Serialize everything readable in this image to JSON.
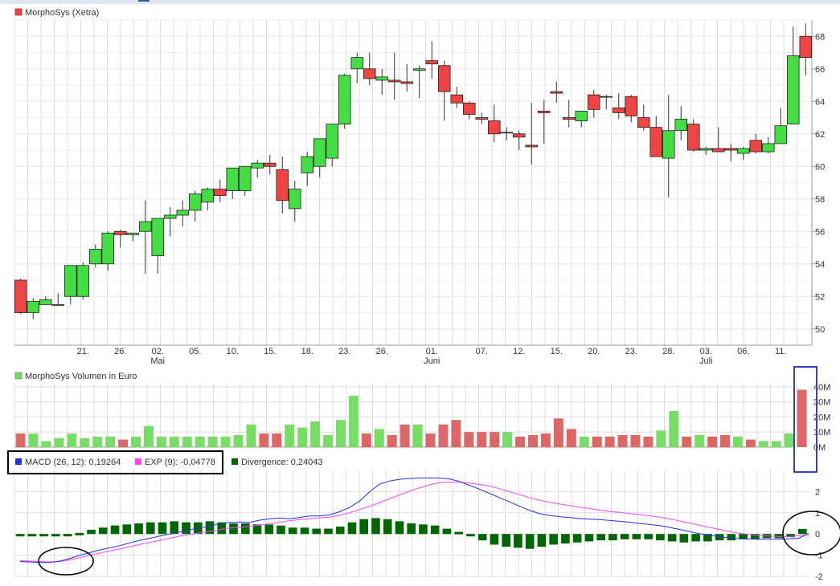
{
  "colors": {
    "up": "#44dd44",
    "down": "#ee4444",
    "vol_up": "#77dd66",
    "vol_down": "#dd6666",
    "macd": "#2233dd",
    "exp": "#ff44ff",
    "divergence": "#006600",
    "grid": "#dddddd",
    "highlight_box": "#3344bb"
  },
  "price_panel": {
    "legend": "MorphoSys (Xetra)",
    "y_ticks": [
      "50",
      "52",
      "54",
      "56",
      "58",
      "60",
      "62",
      "64",
      "66",
      "68"
    ],
    "x_ticks": [
      "21.",
      "26.",
      "02.",
      "05.",
      "10.",
      "15.",
      "18.",
      "23.",
      "26.",
      "01.",
      "07.",
      "12.",
      "15.",
      "20.",
      "23.",
      "28.",
      "03.",
      "06.",
      "11."
    ],
    "month_labels": [
      "Mai",
      "Juni",
      "Juli"
    ]
  },
  "volume_panel": {
    "legend": "MorphoSys Volumen in Euro",
    "y_ticks": [
      "0M",
      "10M",
      "20M",
      "30M",
      "40M"
    ]
  },
  "macd_panel": {
    "macd_legend": "MACD (26, 12): 0,19264",
    "exp_legend": "EXP (9): -0,04778",
    "div_legend": "Divergence: 0,24043",
    "y_ticks": [
      "-2",
      "-1",
      "0",
      "1",
      "2"
    ]
  },
  "chart_data": [
    {
      "type": "candlestick",
      "title": "MorphoSys (Xetra)",
      "ylim": [
        49,
        69
      ],
      "x": [
        "16.04",
        "17.04",
        "18.04",
        "19.04",
        "20.04",
        "21.04",
        "24.04",
        "25.04",
        "26.04",
        "27.04",
        "28.04",
        "02.05",
        "03.05",
        "04.05",
        "05.05",
        "08.05",
        "09.05",
        "10.05",
        "11.05",
        "12.05",
        "15.05",
        "16.05",
        "17.05",
        "18.05",
        "19.05",
        "22.05",
        "23.05",
        "24.05",
        "25.05",
        "26.05",
        "29.05",
        "30.05",
        "31.05",
        "01.06",
        "02.06",
        "05.06",
        "06.06",
        "07.06",
        "08.06",
        "09.06",
        "12.06",
        "13.06",
        "14.06",
        "15.06",
        "16.06",
        "19.06",
        "20.06",
        "21.06",
        "22.06",
        "23.06",
        "26.06",
        "27.06",
        "28.06",
        "29.06",
        "30.06",
        "03.07",
        "04.07",
        "05.07",
        "06.07",
        "07.07",
        "10.07",
        "11.07",
        "12.07",
        "13.07"
      ],
      "open": [
        53.0,
        51.0,
        51.5,
        51.5,
        52.0,
        52.0,
        54.0,
        54.0,
        56.0,
        55.8,
        56.0,
        54.5,
        56.8,
        57.0,
        57.3,
        57.8,
        58.6,
        58.5,
        58.5,
        59.9,
        60.2,
        59.8,
        57.4,
        59.6,
        60.0,
        60.5,
        62.6,
        66.0,
        66.0,
        65.3,
        65.3,
        65.2,
        65.9,
        66.5,
        66.2,
        64.4,
        63.9,
        63.0,
        62.8,
        62.1,
        62.0,
        61.3,
        63.4,
        64.6,
        63.0,
        62.8,
        64.4,
        64.3,
        63.6,
        64.3,
        63.0,
        62.4,
        60.5,
        62.2,
        62.6,
        61.0,
        61.1,
        61.1,
        60.8,
        61.6,
        60.9,
        61.4,
        62.6,
        68.0
      ],
      "high": [
        53.1,
        51.9,
        52.0,
        52.2,
        53.9,
        54.1,
        55.2,
        56.0,
        56.1,
        55.9,
        57.9,
        56.6,
        57.5,
        57.9,
        58.5,
        58.7,
        59.2,
        59.0,
        59.9,
        60.4,
        60.7,
        60.6,
        59.1,
        60.9,
        60.8,
        62.6,
        65.7,
        67.0,
        67.0,
        66.0,
        67.0,
        66.3,
        66.2,
        67.7,
        66.5,
        64.9,
        64.0,
        63.3,
        63.8,
        62.4,
        62.2,
        63.9,
        64.1,
        65.2,
        64.1,
        63.3,
        64.7,
        64.4,
        64.5,
        64.4,
        63.8,
        63.1,
        64.4,
        63.7,
        62.9,
        61.2,
        62.4,
        61.4,
        61.2,
        62.0,
        61.8,
        63.6,
        68.6,
        68.8
      ],
      "low": [
        50.9,
        50.6,
        51.5,
        51.5,
        51.5,
        51.8,
        53.8,
        53.6,
        55.0,
        55.4,
        53.4,
        53.4,
        55.7,
        56.3,
        56.6,
        57.3,
        57.8,
        58.0,
        58.2,
        59.3,
        59.5,
        57.1,
        56.6,
        58.8,
        59.3,
        60.0,
        62.3,
        65.1,
        65.0,
        64.4,
        64.1,
        64.6,
        64.2,
        65.4,
        62.8,
        63.6,
        62.9,
        62.6,
        61.5,
        61.6,
        61.0,
        60.1,
        61.4,
        63.9,
        62.4,
        62.4,
        63.0,
        63.5,
        62.9,
        62.7,
        62.2,
        60.6,
        58.1,
        61.6,
        60.9,
        60.7,
        61.0,
        60.3,
        60.4,
        60.8,
        60.8,
        61.6,
        65.8,
        65.6
      ],
      "close": [
        51.0,
        51.7,
        51.8,
        51.5,
        53.9,
        53.9,
        54.9,
        55.9,
        55.8,
        55.9,
        56.6,
        56.8,
        57.0,
        57.3,
        58.3,
        58.6,
        58.2,
        59.9,
        60.0,
        60.2,
        60.0,
        57.9,
        58.6,
        60.6,
        61.7,
        62.6,
        65.6,
        66.7,
        65.4,
        65.5,
        65.2,
        65.1,
        66.0,
        66.3,
        64.6,
        63.9,
        63.2,
        62.9,
        62.0,
        62.1,
        61.8,
        61.2,
        63.3,
        64.5,
        62.9,
        63.4,
        63.5,
        64.3,
        63.3,
        63.1,
        62.4,
        60.6,
        62.2,
        62.9,
        61.0,
        61.1,
        60.9,
        61.0,
        61.1,
        60.9,
        61.4,
        62.5,
        66.8,
        66.7
      ]
    },
    {
      "type": "bar",
      "title": "MorphoSys Volumen in Euro",
      "ylim": [
        0,
        40
      ],
      "values": [
        9,
        9,
        4,
        6,
        9,
        6,
        7,
        7,
        5,
        7,
        14,
        7,
        7,
        7,
        7,
        7,
        7,
        8,
        15,
        9,
        9,
        15,
        13,
        17,
        8,
        18,
        34,
        9,
        12,
        8,
        15,
        15,
        9,
        15,
        18,
        10,
        10,
        10,
        10,
        7,
        8,
        9,
        19,
        12,
        7,
        7,
        7,
        8,
        8,
        7,
        11,
        24,
        7,
        8,
        7,
        8,
        7,
        5,
        4,
        4,
        9,
        38
      ]
    },
    {
      "type": "bar+line",
      "title": "MACD",
      "ylim": [
        -2,
        3
      ],
      "macd": [
        -1.3,
        -1.32,
        -1.35,
        -1.35,
        -1.28,
        -1.15,
        -1.0,
        -0.88,
        -0.75,
        -0.65,
        -0.55,
        -0.42,
        -0.3,
        -0.2,
        -0.1,
        0.0,
        0.1,
        0.2,
        0.3,
        0.36,
        0.5,
        0.55,
        0.57,
        0.55,
        0.65,
        0.72,
        0.75,
        0.72,
        0.78,
        0.85,
        0.85,
        0.9,
        1.05,
        1.25,
        1.55,
        1.98,
        2.35,
        2.5,
        2.58,
        2.62,
        2.64,
        2.65,
        2.64,
        2.6,
        2.48,
        2.3,
        2.12,
        1.92,
        1.72,
        1.52,
        1.32,
        1.12,
        0.97,
        0.88,
        0.82,
        0.78,
        0.73,
        0.7,
        0.68,
        0.64,
        0.6,
        0.56,
        0.5,
        0.45,
        0.4,
        0.32,
        0.22,
        0.12,
        0.02,
        -0.06,
        -0.12,
        -0.18,
        -0.22,
        -0.24,
        -0.25,
        -0.25,
        -0.25,
        -0.23,
        -0.2,
        0.03
      ],
      "exp": [
        -1.25,
        -1.28,
        -1.3,
        -1.32,
        -1.3,
        -1.22,
        -1.12,
        -1.0,
        -0.9,
        -0.8,
        -0.7,
        -0.6,
        -0.5,
        -0.4,
        -0.3,
        -0.2,
        -0.1,
        -0.02,
        0.05,
        0.12,
        0.2,
        0.28,
        0.32,
        0.36,
        0.42,
        0.48,
        0.55,
        0.62,
        0.68,
        0.72,
        0.76,
        0.8,
        0.88,
        1.0,
        1.15,
        1.3,
        1.48,
        1.66,
        1.85,
        2.02,
        2.18,
        2.32,
        2.42,
        2.45,
        2.44,
        2.4,
        2.34,
        2.26,
        2.14,
        2.0,
        1.86,
        1.72,
        1.6,
        1.5,
        1.42,
        1.34,
        1.27,
        1.2,
        1.13,
        1.07,
        1.02,
        0.97,
        0.92,
        0.86,
        0.8,
        0.72,
        0.62,
        0.52,
        0.42,
        0.32,
        0.22,
        0.12,
        0.04,
        -0.02,
        -0.07,
        -0.1,
        -0.12,
        -0.12,
        -0.08,
        -0.05
      ],
      "divergence": [
        -0.05,
        -0.05,
        -0.05,
        -0.05,
        0.0,
        0.05,
        0.2,
        0.3,
        0.4,
        0.45,
        0.5,
        0.55,
        0.55,
        0.6,
        0.55,
        0.55,
        0.6,
        0.55,
        0.5,
        0.5,
        0.45,
        0.45,
        0.4,
        0.3,
        0.3,
        0.25,
        0.25,
        0.35,
        0.55,
        0.7,
        0.75,
        0.7,
        0.6,
        0.5,
        0.45,
        0.4,
        0.25,
        0.1,
        -0.1,
        -0.3,
        -0.5,
        -0.6,
        -0.65,
        -0.7,
        -0.6,
        -0.5,
        -0.45,
        -0.4,
        -0.35,
        -0.3,
        -0.3,
        -0.25,
        -0.25,
        -0.25,
        -0.3,
        -0.35,
        -0.4,
        -0.35,
        -0.35,
        -0.3,
        -0.3,
        -0.25,
        -0.25,
        -0.2,
        -0.2,
        -0.15,
        0.24
      ]
    }
  ]
}
